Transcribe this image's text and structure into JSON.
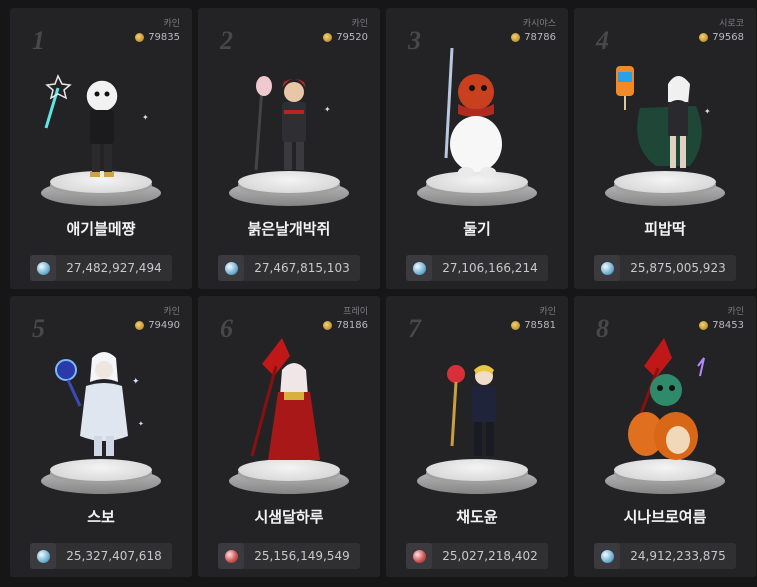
{
  "rankings": [
    {
      "rank": "1",
      "server": "카인",
      "fame": "79835",
      "name": "애기블메쨩",
      "power": "27,482,927,494",
      "power_icon": "crystal-icon"
    },
    {
      "rank": "2",
      "server": "카인",
      "fame": "79520",
      "name": "붉은날개박쥐",
      "power": "27,467,815,103",
      "power_icon": "crystal-icon"
    },
    {
      "rank": "3",
      "server": "카시야스",
      "fame": "78786",
      "name": "둘기",
      "power": "27,106,166,214",
      "power_icon": "crystal-icon"
    },
    {
      "rank": "4",
      "server": "시로코",
      "fame": "79568",
      "name": "피밥딱",
      "power": "25,875,005,923",
      "power_icon": "crystal-icon"
    },
    {
      "rank": "5",
      "server": "카인",
      "fame": "79490",
      "name": "스보",
      "power": "25,327,407,618",
      "power_icon": "crystal-icon"
    },
    {
      "rank": "6",
      "server": "프레이",
      "fame": "78186",
      "name": "시샘달하루",
      "power": "25,156,149,549",
      "power_icon": "blood-orb-icon"
    },
    {
      "rank": "7",
      "server": "카인",
      "fame": "78581",
      "name": "채도윤",
      "power": "25,027,218,402",
      "power_icon": "blood-orb-icon"
    },
    {
      "rank": "8",
      "server": "카인",
      "fame": "78453",
      "name": "시나브로여름",
      "power": "24,912,233,875",
      "power_icon": "crystal-icon"
    }
  ],
  "colors": {
    "background": "#161617",
    "card": "#232325",
    "fame_gold": "#d8a93a",
    "power_box": "#303033"
  }
}
